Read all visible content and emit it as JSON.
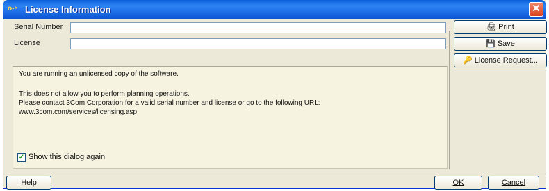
{
  "window": {
    "title": "License Information",
    "title_icon": "key-icon",
    "close_glyph": "✕"
  },
  "form": {
    "serial_label": "Serial Number",
    "serial_value": "",
    "license_label": "License",
    "license_value": ""
  },
  "messages": {
    "line1": "You are running an unlicensed copy of the software.",
    "line2": "This does not allow you to perform planning operations.",
    "line3": "Please contact 3Com Corporation for a valid serial number and license or go to the following URL:",
    "line4": "www.3com.com/services/licensing.asp"
  },
  "checkbox": {
    "label": "Show this dialog again",
    "checked": true,
    "check_glyph": "✓"
  },
  "side_buttons": {
    "print_label": "Print",
    "save_label": "Save",
    "license_request_label": "License Request..."
  },
  "footer": {
    "help_label": "Help",
    "ok_label": "OK",
    "cancel_label": "Cancel"
  },
  "colors": {
    "titlebar": "#0a5eda",
    "close": "#d8431c",
    "dialog_bg": "#ece9d8",
    "message_bg": "#f6f3e1"
  }
}
